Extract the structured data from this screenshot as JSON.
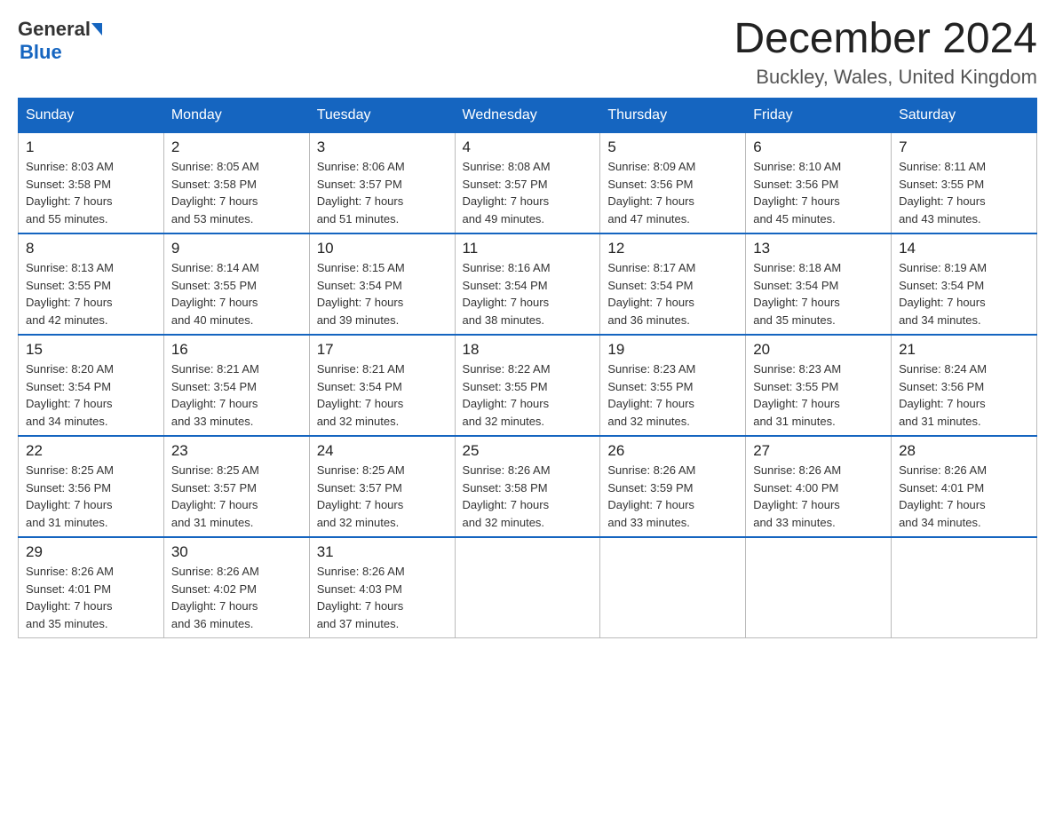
{
  "logo": {
    "general": "General",
    "blue": "Blue"
  },
  "header": {
    "title": "December 2024",
    "location": "Buckley, Wales, United Kingdom"
  },
  "weekdays": [
    "Sunday",
    "Monday",
    "Tuesday",
    "Wednesday",
    "Thursday",
    "Friday",
    "Saturday"
  ],
  "weeks": [
    [
      {
        "day": "1",
        "sunrise": "8:03 AM",
        "sunset": "3:58 PM",
        "daylight": "7 hours and 55 minutes."
      },
      {
        "day": "2",
        "sunrise": "8:05 AM",
        "sunset": "3:58 PM",
        "daylight": "7 hours and 53 minutes."
      },
      {
        "day": "3",
        "sunrise": "8:06 AM",
        "sunset": "3:57 PM",
        "daylight": "7 hours and 51 minutes."
      },
      {
        "day": "4",
        "sunrise": "8:08 AM",
        "sunset": "3:57 PM",
        "daylight": "7 hours and 49 minutes."
      },
      {
        "day": "5",
        "sunrise": "8:09 AM",
        "sunset": "3:56 PM",
        "daylight": "7 hours and 47 minutes."
      },
      {
        "day": "6",
        "sunrise": "8:10 AM",
        "sunset": "3:56 PM",
        "daylight": "7 hours and 45 minutes."
      },
      {
        "day": "7",
        "sunrise": "8:11 AM",
        "sunset": "3:55 PM",
        "daylight": "7 hours and 43 minutes."
      }
    ],
    [
      {
        "day": "8",
        "sunrise": "8:13 AM",
        "sunset": "3:55 PM",
        "daylight": "7 hours and 42 minutes."
      },
      {
        "day": "9",
        "sunrise": "8:14 AM",
        "sunset": "3:55 PM",
        "daylight": "7 hours and 40 minutes."
      },
      {
        "day": "10",
        "sunrise": "8:15 AM",
        "sunset": "3:54 PM",
        "daylight": "7 hours and 39 minutes."
      },
      {
        "day": "11",
        "sunrise": "8:16 AM",
        "sunset": "3:54 PM",
        "daylight": "7 hours and 38 minutes."
      },
      {
        "day": "12",
        "sunrise": "8:17 AM",
        "sunset": "3:54 PM",
        "daylight": "7 hours and 36 minutes."
      },
      {
        "day": "13",
        "sunrise": "8:18 AM",
        "sunset": "3:54 PM",
        "daylight": "7 hours and 35 minutes."
      },
      {
        "day": "14",
        "sunrise": "8:19 AM",
        "sunset": "3:54 PM",
        "daylight": "7 hours and 34 minutes."
      }
    ],
    [
      {
        "day": "15",
        "sunrise": "8:20 AM",
        "sunset": "3:54 PM",
        "daylight": "7 hours and 34 minutes."
      },
      {
        "day": "16",
        "sunrise": "8:21 AM",
        "sunset": "3:54 PM",
        "daylight": "7 hours and 33 minutes."
      },
      {
        "day": "17",
        "sunrise": "8:21 AM",
        "sunset": "3:54 PM",
        "daylight": "7 hours and 32 minutes."
      },
      {
        "day": "18",
        "sunrise": "8:22 AM",
        "sunset": "3:55 PM",
        "daylight": "7 hours and 32 minutes."
      },
      {
        "day": "19",
        "sunrise": "8:23 AM",
        "sunset": "3:55 PM",
        "daylight": "7 hours and 32 minutes."
      },
      {
        "day": "20",
        "sunrise": "8:23 AM",
        "sunset": "3:55 PM",
        "daylight": "7 hours and 31 minutes."
      },
      {
        "day": "21",
        "sunrise": "8:24 AM",
        "sunset": "3:56 PM",
        "daylight": "7 hours and 31 minutes."
      }
    ],
    [
      {
        "day": "22",
        "sunrise": "8:25 AM",
        "sunset": "3:56 PM",
        "daylight": "7 hours and 31 minutes."
      },
      {
        "day": "23",
        "sunrise": "8:25 AM",
        "sunset": "3:57 PM",
        "daylight": "7 hours and 31 minutes."
      },
      {
        "day": "24",
        "sunrise": "8:25 AM",
        "sunset": "3:57 PM",
        "daylight": "7 hours and 32 minutes."
      },
      {
        "day": "25",
        "sunrise": "8:26 AM",
        "sunset": "3:58 PM",
        "daylight": "7 hours and 32 minutes."
      },
      {
        "day": "26",
        "sunrise": "8:26 AM",
        "sunset": "3:59 PM",
        "daylight": "7 hours and 33 minutes."
      },
      {
        "day": "27",
        "sunrise": "8:26 AM",
        "sunset": "4:00 PM",
        "daylight": "7 hours and 33 minutes."
      },
      {
        "day": "28",
        "sunrise": "8:26 AM",
        "sunset": "4:01 PM",
        "daylight": "7 hours and 34 minutes."
      }
    ],
    [
      {
        "day": "29",
        "sunrise": "8:26 AM",
        "sunset": "4:01 PM",
        "daylight": "7 hours and 35 minutes."
      },
      {
        "day": "30",
        "sunrise": "8:26 AM",
        "sunset": "4:02 PM",
        "daylight": "7 hours and 36 minutes."
      },
      {
        "day": "31",
        "sunrise": "8:26 AM",
        "sunset": "4:03 PM",
        "daylight": "7 hours and 37 minutes."
      },
      null,
      null,
      null,
      null
    ]
  ],
  "labels": {
    "sunrise": "Sunrise:",
    "sunset": "Sunset:",
    "daylight": "Daylight:"
  }
}
